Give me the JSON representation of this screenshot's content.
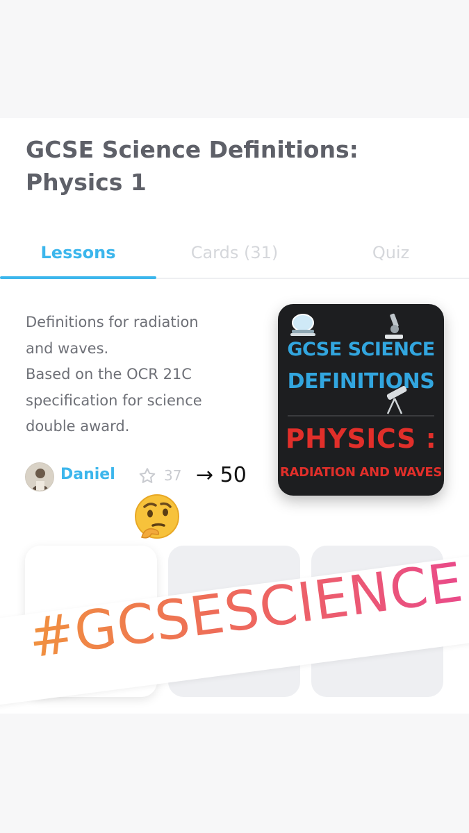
{
  "deck": {
    "title_line1": "GCSE Science Definitions:",
    "title_line2": "Physics 1"
  },
  "tabs": [
    {
      "label": "Lessons",
      "active": true
    },
    {
      "label": "Cards (31)",
      "active": false
    },
    {
      "label": "Quiz",
      "active": false
    }
  ],
  "description": {
    "lines": [
      "Definitions for radiation",
      "and waves.",
      "Based on the OCR 21C",
      "specification for science",
      "double award."
    ]
  },
  "author": {
    "name": "Daniel",
    "stars": "37",
    "annotation": "→ 50"
  },
  "cover": {
    "line1": "GCSE SCIENCE",
    "line2": "DEFINITIONS",
    "line3": "PHYSICS :",
    "line4": "RADIATION AND WAVES"
  },
  "sticker": {
    "hashtag": "#GCSESCIENCE",
    "emoji": "thinking-face-icon"
  },
  "colors": {
    "accent": "#3cb6ec",
    "title": "#5e6068",
    "cover_blue": "#32a6df",
    "cover_red": "#e12f2a",
    "gradient_start": "#f0913f",
    "gradient_end": "#e9498b"
  }
}
